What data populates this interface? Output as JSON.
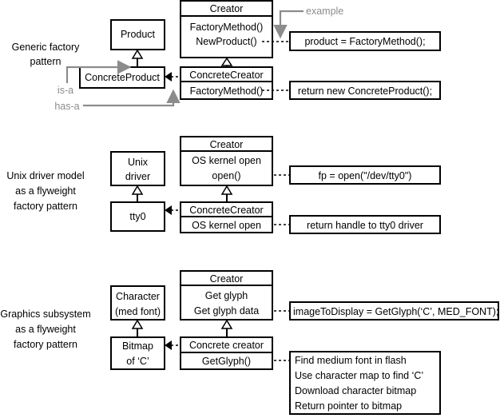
{
  "generic": {
    "label": [
      "Generic factory",
      "pattern"
    ],
    "creator": {
      "title": "Creator",
      "methods": [
        "FactoryMethod()",
        "NewProduct()"
      ]
    },
    "product": "Product",
    "concrete_product": "ConcreteProduct",
    "concrete_creator": {
      "title": "ConcreteCreator",
      "method": "FactoryMethod()"
    },
    "code": [
      "product = FactoryMethod();",
      "return new ConcreteProduct();"
    ],
    "annotations": {
      "example": "example",
      "is_a": "is-a",
      "has_a": "has-a"
    }
  },
  "unix": {
    "label": [
      "Unix driver model",
      "as a flyweight",
      "factory pattern"
    ],
    "creator": {
      "title": "Creator",
      "methods": [
        "OS kernel open",
        "open()"
      ]
    },
    "product": [
      "Unix",
      "driver"
    ],
    "concrete_product": "tty0",
    "concrete_creator": {
      "title": "ConcreteCreator",
      "method": "OS kernel open"
    },
    "code": [
      "fp = open(\"/dev/tty0\")",
      "return handle to tty0 driver"
    ]
  },
  "graphics": {
    "label": [
      "Graphics subsystem",
      "as a flyweight",
      "factory pattern"
    ],
    "creator": {
      "title": "Creator",
      "methods": [
        "Get glyph",
        "Get glyph data"
      ]
    },
    "product": [
      "Character",
      "(med font)"
    ],
    "concrete_product": [
      "Bitmap",
      "of ‘C’"
    ],
    "concrete_creator": {
      "title": "Concrete creator",
      "method": "GetGlyph()"
    },
    "code": [
      "imageToDisplay = GetGlyph(‘C’, MED_FONT);"
    ],
    "steps": [
      "Find medium font in flash",
      "Use character map to find ‘C’",
      "Download character bitmap",
      "Return pointer to bitmap"
    ]
  },
  "colors": {
    "annotation": "#8c8c8c",
    "line": "#000000"
  }
}
